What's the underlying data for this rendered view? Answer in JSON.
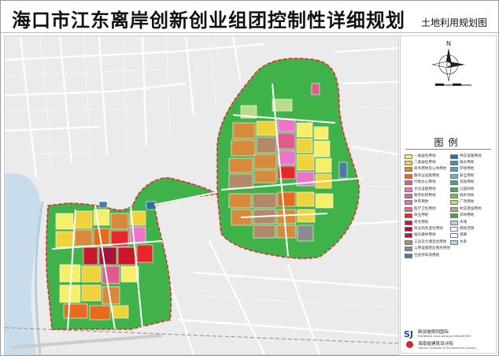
{
  "header": {
    "title": "海口市江东离岸创新创业组团控制性详细规划",
    "subtitle": "土地利用规划图"
  },
  "compass": {
    "north_label": "N"
  },
  "legend": {
    "title": "图例",
    "items": [
      {
        "label": "一类居住用地",
        "color": "#f5ef6a"
      },
      {
        "label": "二类居住用地",
        "color": "#f0d23c"
      },
      {
        "label": "商务用地及公共用地",
        "color": "#d88a3c"
      },
      {
        "label": "服务业设施用地",
        "color": "#e86a1e"
      },
      {
        "label": "行政办公用地",
        "color": "#e05a8a"
      },
      {
        "label": "文化设施用地",
        "color": "#ee74c8"
      },
      {
        "label": "教育科研用地",
        "color": "#c86aa8"
      },
      {
        "label": "体育用地",
        "color": "#d27ab4"
      },
      {
        "label": "医疗卫生用地",
        "color": "#d86c9a"
      },
      {
        "label": "商业用地",
        "color": "#e8262c"
      },
      {
        "label": "商务用地",
        "color": "#c8182a"
      },
      {
        "label": "商业商务混合用地",
        "color": "#a81238"
      },
      {
        "label": "娱乐康体用地",
        "color": "#b4194e"
      },
      {
        "label": "工业及仓储混合用地",
        "color": "#b28a6a"
      },
      {
        "label": "公用设施营业网点用地",
        "color": "#8c8c8c"
      },
      {
        "label": "社会停车场用地",
        "color": "#4a7aa8"
      },
      {
        "label": "供应设施用地",
        "color": "#2e6ea6"
      },
      {
        "label": "排水用地",
        "color": "#3f8ec4"
      },
      {
        "label": "环境用地",
        "color": "#4ba6c8"
      },
      {
        "label": "安全用地",
        "color": "#6cb6c4"
      },
      {
        "label": "消防用地",
        "color": "#4f9c9c"
      },
      {
        "label": "公园绿地",
        "color": "#3fb24a"
      },
      {
        "label": "防护绿地",
        "color": "#7ac142"
      },
      {
        "label": "广场用地",
        "color": "#b9dc8c"
      },
      {
        "label": "村庄建设用地",
        "color": "#b7a28a"
      },
      {
        "label": "农林用地",
        "color": "#39a84a"
      },
      {
        "label": "水域",
        "color": "#a8d8ee"
      },
      {
        "label": "规划范围",
        "color": "#ffffff"
      },
      {
        "label": "道路",
        "color": "#ffffff"
      },
      {
        "label": "水系",
        "color": "#a8d8ee"
      }
    ]
  },
  "credits": {
    "logo_mark": "SJ",
    "org1": "新加坡规划国际",
    "org1_en": "SURBANA International SINGAPORE",
    "org2": "海南省建筑设计院",
    "org2_en": "Hainan Institute of Architecture Design"
  },
  "colors": {
    "background_map": "#ececec",
    "river": "#c9dceb",
    "green": "#3fb24a",
    "boundary": "#e0262c"
  }
}
